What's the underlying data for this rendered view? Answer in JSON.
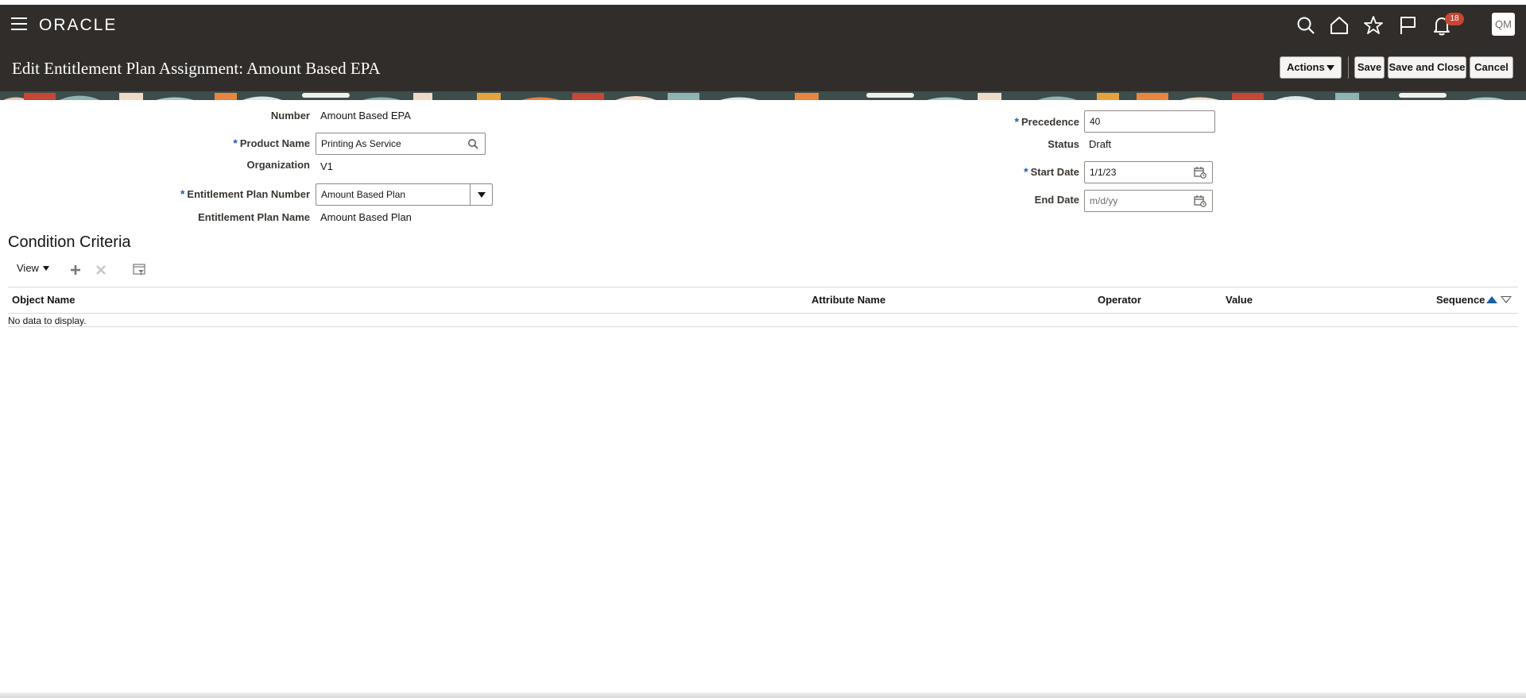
{
  "header": {
    "brand": "ORACLE",
    "notification_count": "18",
    "user_initials": "QM",
    "page_title": "Edit Entitlement Plan Assignment: Amount Based EPA",
    "actions_label": "Actions",
    "save_label": "Save",
    "save_close_label": "Save and Close",
    "cancel_label": "Cancel"
  },
  "form": {
    "number_label": "Number",
    "number_value": "Amount Based EPA",
    "product_name_label": "Product Name",
    "product_name_value": "Printing As Service",
    "organization_label": "Organization",
    "organization_value": "V1",
    "plan_number_label": "Entitlement Plan Number",
    "plan_number_value": "Amount Based Plan",
    "plan_name_label": "Entitlement Plan Name",
    "plan_name_value": "Amount Based Plan",
    "precedence_label": "Precedence",
    "precedence_value": "40",
    "status_label": "Status",
    "status_value": "Draft",
    "start_date_label": "Start Date",
    "start_date_value": "1/1/23",
    "end_date_label": "End Date",
    "end_date_placeholder": "m/d/yy",
    "required_marker": "*"
  },
  "criteria": {
    "title": "Condition Criteria",
    "view_label": "View",
    "columns": [
      "Object Name",
      "Attribute Name",
      "Operator",
      "Value",
      "Sequence"
    ],
    "empty_text": "No data to display."
  },
  "colors": {
    "header_bg": "#312d2a",
    "required": "#1d5fa5",
    "badge": "#c74634"
  }
}
